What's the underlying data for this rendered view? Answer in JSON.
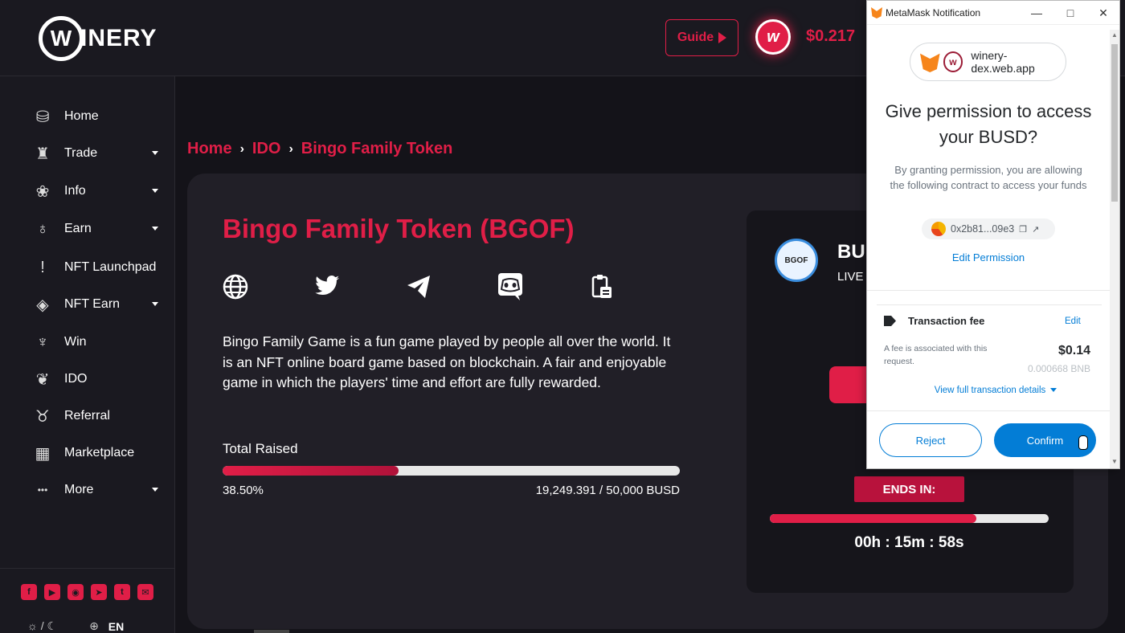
{
  "header": {
    "logo_text": "INERY",
    "logo_letter": "W",
    "guide_label": "Guide",
    "token_letter": "w",
    "price": "$0.217"
  },
  "sidebar": {
    "items": [
      {
        "label": "Home",
        "icon": "barrel-icon"
      },
      {
        "label": "Trade",
        "icon": "bottles-icon",
        "has_submenu": true
      },
      {
        "label": "Info",
        "icon": "grapes-icon",
        "has_submenu": true
      },
      {
        "label": "Earn",
        "icon": "glasses-icon",
        "has_submenu": true
      },
      {
        "label": "NFT Launchpad",
        "icon": "bottle-icon"
      },
      {
        "label": "NFT Earn",
        "icon": "nft-icon",
        "has_submenu": true
      },
      {
        "label": "Win",
        "icon": "trophy-icon"
      },
      {
        "label": "IDO",
        "icon": "vine-icon"
      },
      {
        "label": "Referral",
        "icon": "cheers-icon"
      },
      {
        "label": "Marketplace",
        "icon": "store-icon"
      },
      {
        "label": "More",
        "icon": "dots-icon",
        "has_submenu": true
      }
    ],
    "socials": [
      "facebook-icon",
      "youtube-icon",
      "discord-icon",
      "telegram-icon",
      "twitter-icon",
      "mail-icon"
    ],
    "language": "EN"
  },
  "breadcrumb": [
    "Home",
    "IDO",
    "Bingo Family Token"
  ],
  "project": {
    "title": "Bingo Family Token (BGOF)",
    "links": [
      "globe-icon",
      "twitter-icon",
      "telegram-icon",
      "discord-icon",
      "clipboard-icon"
    ],
    "description": "Bingo Family Game is a fun game played by people all over the world. It is an NFT online board game based on blockchain. A fair and enjoyable game in which the players' time and effort are fully rewarded.",
    "raised_label": "Total Raised",
    "raised_fraction": 0.385,
    "raised_percent": "38.50%",
    "raised_amount": "19,249.391 / 50,000 BUSD"
  },
  "panel": {
    "avatar_text": "BGOF",
    "name": "BU",
    "status": "LIVE",
    "ends_label": "ENDS IN:",
    "timer_fraction": 0.74,
    "countdown": "00h : 15m : 58s"
  },
  "metamask": {
    "window_title": "MetaMask Notification",
    "site": "winery-dex.web.app",
    "heading": "Give permission to access your BUSD?",
    "subtext": "By granting permission, you are allowing the following contract to access your funds",
    "address": "0x2b81...09e3",
    "edit_permission": "Edit Permission",
    "fee_title": "Transaction fee",
    "fee_edit": "Edit",
    "fee_note": "A fee is associated with this request.",
    "fee_usd": "$0.14",
    "fee_bnb": "0.000668 BNB",
    "view_details": "View full transaction details",
    "reject": "Reject",
    "confirm": "Confirm",
    "accent": "#037dd6"
  },
  "colors": {
    "brand": "#e01e47",
    "background": "#141319",
    "card": "#211f27"
  }
}
